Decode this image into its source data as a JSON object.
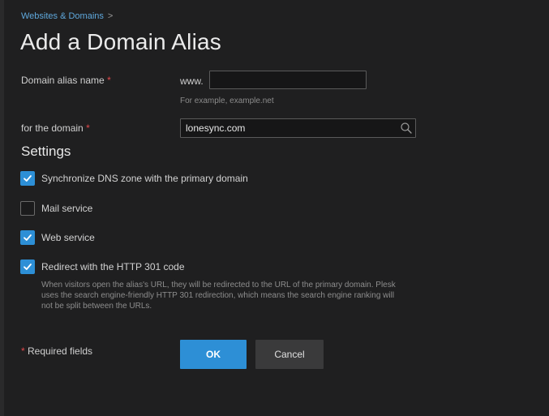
{
  "breadcrumb": {
    "link": "Websites & Domains",
    "separator": ">"
  },
  "page": {
    "title": "Add a Domain Alias"
  },
  "alias_field": {
    "label": "Domain alias name",
    "required_mark": "*",
    "prefix": "www.",
    "value": "",
    "hint": "For example, example.net"
  },
  "domain_field": {
    "label": "for the domain",
    "required_mark": "*",
    "value": "lonesync.com",
    "icon": "search-icon"
  },
  "settings": {
    "title": "Settings",
    "options": [
      {
        "label": "Synchronize DNS zone with the primary domain",
        "checked": true
      },
      {
        "label": "Mail service",
        "checked": false
      },
      {
        "label": "Web service",
        "checked": true
      },
      {
        "label": "Redirect with the HTTP 301 code",
        "checked": true
      }
    ],
    "redirect_description": "When visitors open the alias's URL, they will be redirected to the URL of the primary domain. Plesk uses the search engine-friendly HTTP 301 redirection, which means the search engine ranking will not be split between the URLs."
  },
  "footer": {
    "required_mark": "*",
    "required_text": "Required fields",
    "ok_label": "OK",
    "cancel_label": "Cancel"
  },
  "colors": {
    "accent": "#2d8fd6",
    "background": "#1f1f20",
    "required": "#e0484b",
    "link": "#5fa8dc"
  }
}
